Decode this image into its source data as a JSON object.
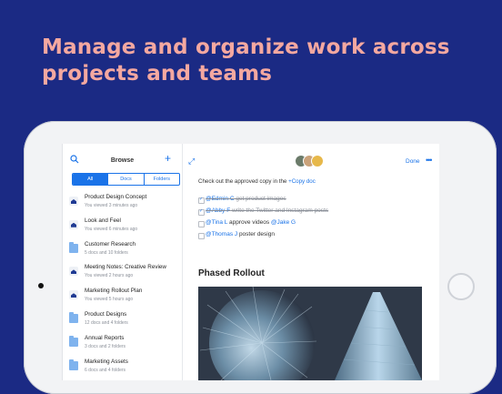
{
  "headline": {
    "line1": "Manage and organize work across",
    "line2": "projects and teams"
  },
  "sidebar": {
    "title": "Browse",
    "segments": [
      "All",
      "Docs",
      "Folders"
    ],
    "items": [
      {
        "name": "Product Design Concept",
        "sub": "You viewed 3 minutes ago",
        "icon": "document-icon"
      },
      {
        "name": "Look and Feel",
        "sub": "You viewed 6 minutes ago",
        "icon": "document-icon"
      },
      {
        "name": "Customer Research",
        "sub": "5 docs and 10 folders",
        "icon": "folder-icon"
      },
      {
        "name": "Meeting Notes: Creative Review",
        "sub": "You viewed 2 hours ago",
        "icon": "document-icon"
      },
      {
        "name": "Marketing Rollout Plan",
        "sub": "You viewed 5 hours ago",
        "icon": "document-icon"
      },
      {
        "name": "Product Designs",
        "sub": "12 docs and 4 folders",
        "icon": "folder-icon"
      },
      {
        "name": "Annual Reports",
        "sub": "3 docs and 2 folders",
        "icon": "folder-icon"
      },
      {
        "name": "Marketing Assets",
        "sub": "6 docs and 4 folders",
        "icon": "folder-icon"
      }
    ]
  },
  "editor": {
    "done_label": "Done",
    "more_label": "•••",
    "intro_text": "Check out the approved copy in the ",
    "intro_link": "+Copy doc",
    "todos": [
      {
        "mention": "@Edmin C",
        "text": " get product images",
        "checked": true
      },
      {
        "mention": "@Abby F",
        "text": " write the Twitter and Instagram posts",
        "checked": true
      },
      {
        "mention": "@Tina L",
        "text": " approve videos ",
        "mention2": "@Jake G",
        "checked": false
      },
      {
        "mention": "@Thomas J",
        "text": " poster design",
        "checked": false
      }
    ],
    "heading": "Phased Rollout"
  },
  "colors": {
    "background": "#1b2a84",
    "headline": "#f4a8a0",
    "accent": "#1a73e8"
  }
}
